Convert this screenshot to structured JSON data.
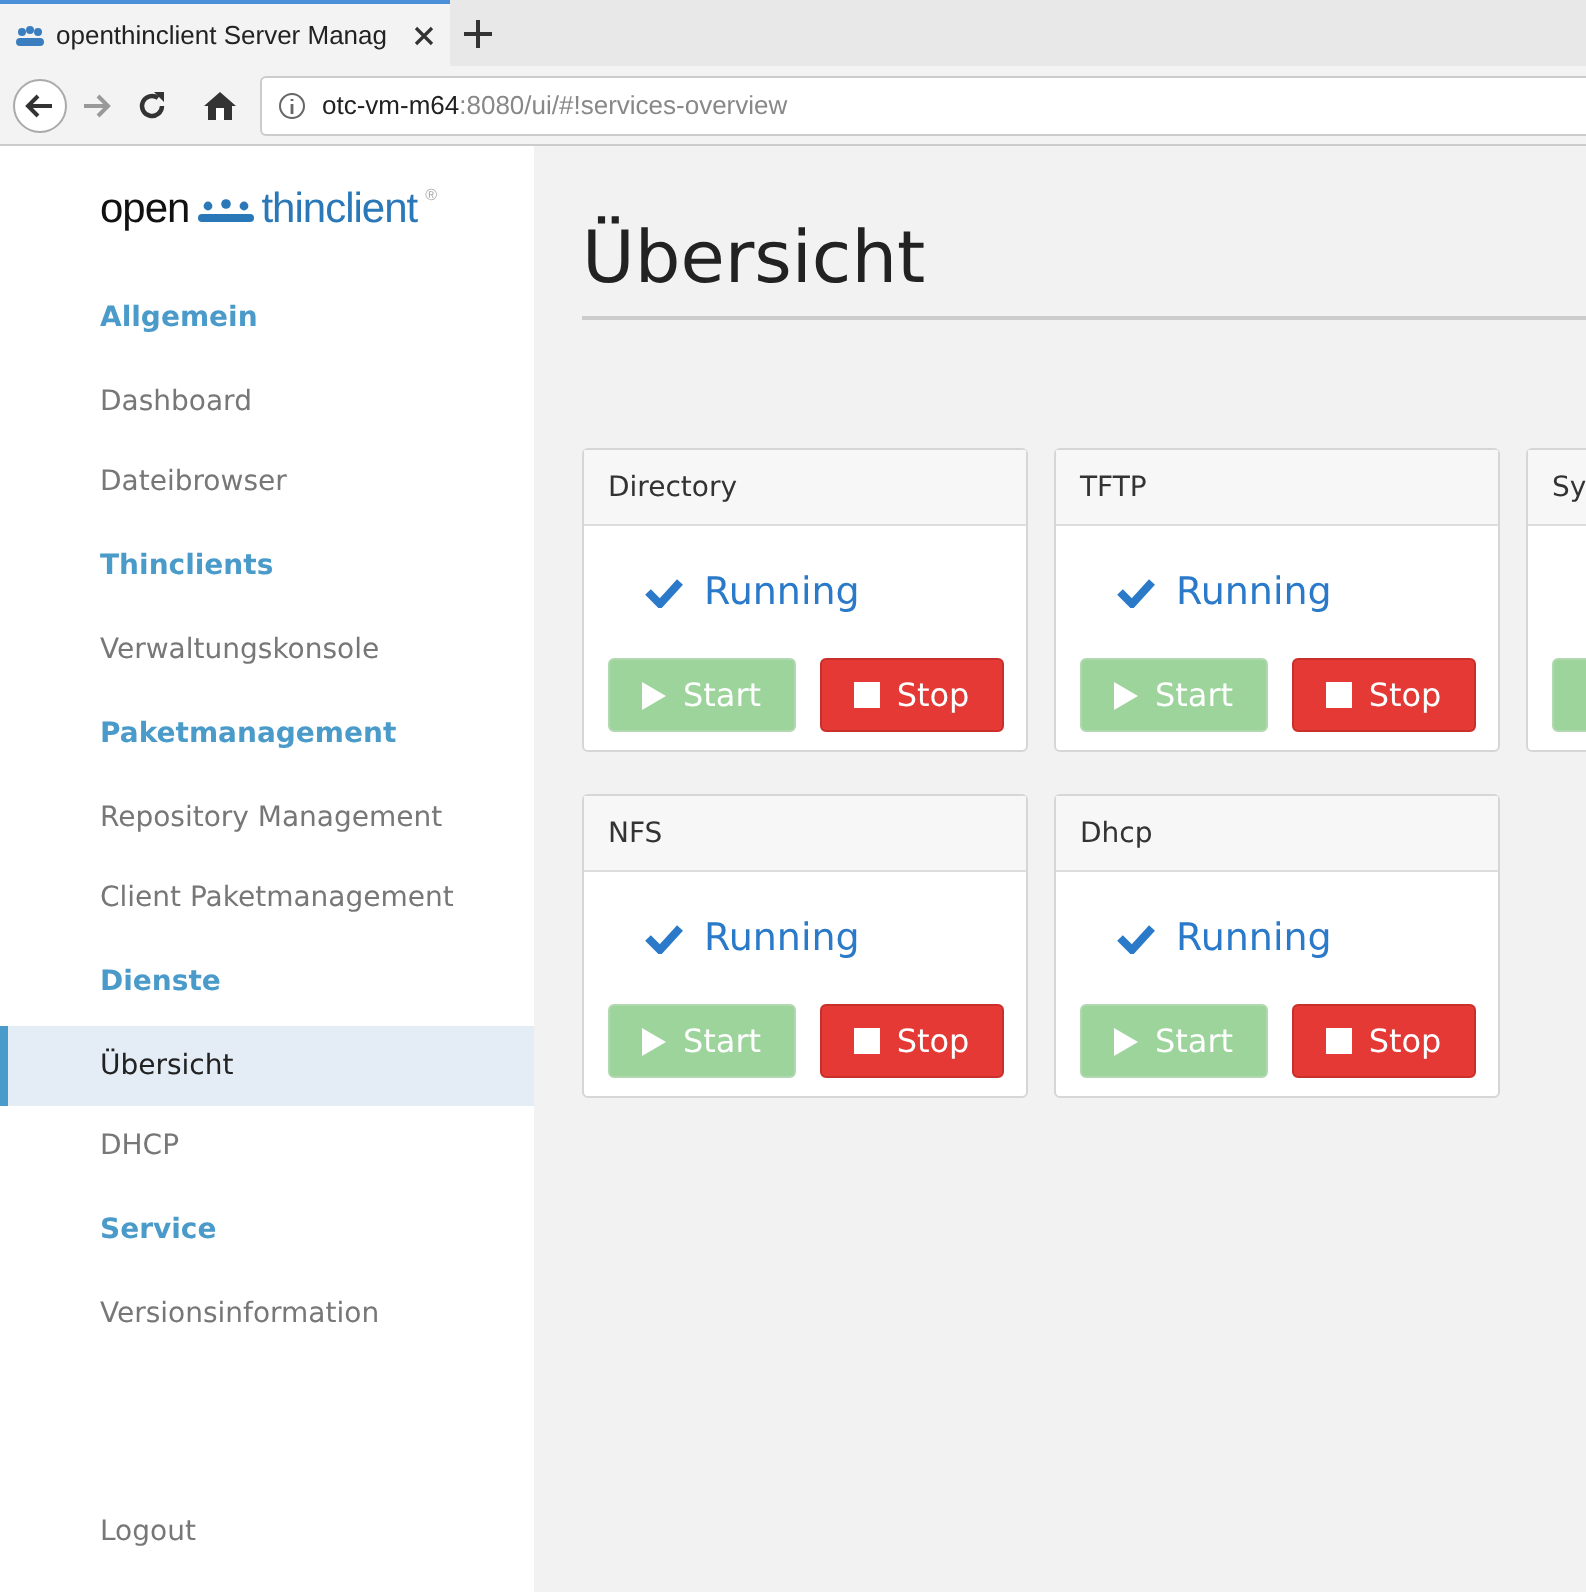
{
  "browser": {
    "tab_title": "openthinclient Server Manag",
    "url_host": "otc-vm-m64",
    "url_path": ":8080/ui/#!services-overview"
  },
  "logo": {
    "left": "open",
    "right": "thinclient",
    "mark": "®"
  },
  "sidebar": [
    {
      "heading": "Allgemein",
      "items": [
        {
          "label": "Dashboard",
          "selected": false
        },
        {
          "label": "Dateibrowser",
          "selected": false
        }
      ]
    },
    {
      "heading": "Thinclients",
      "items": [
        {
          "label": "Verwaltungskonsole",
          "selected": false
        }
      ]
    },
    {
      "heading": "Paketmanagement",
      "items": [
        {
          "label": "Repository Management",
          "selected": false
        },
        {
          "label": "Client Paketmanagement",
          "selected": false
        }
      ]
    },
    {
      "heading": "Dienste",
      "items": [
        {
          "label": "Übersicht",
          "selected": true
        },
        {
          "label": "DHCP",
          "selected": false
        }
      ]
    },
    {
      "heading": "Service",
      "items": [
        {
          "label": "Versionsinformation",
          "selected": false
        }
      ]
    }
  ],
  "logout": "Logout",
  "page_title": "Übersicht",
  "services": [
    {
      "name": "Directory",
      "status": "Running",
      "start": "Start",
      "stop": "Stop",
      "start_disabled": true
    },
    {
      "name": "TFTP",
      "status": "Running",
      "start": "Start",
      "stop": "Stop",
      "start_disabled": true
    },
    {
      "name": "Sy",
      "start_disabled": true
    },
    {
      "name": "NFS",
      "status": "Running",
      "start": "Start",
      "stop": "Stop",
      "start_disabled": true
    },
    {
      "name": "Dhcp",
      "status": "Running",
      "start": "Start",
      "stop": "Stop",
      "start_disabled": true
    }
  ]
}
